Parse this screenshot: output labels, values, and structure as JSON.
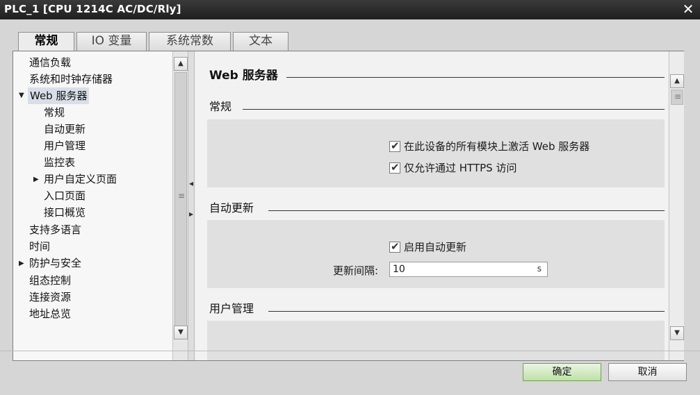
{
  "window": {
    "title": "PLC_1 [CPU 1214C AC/DC/Rly]",
    "close_glyph": "✕"
  },
  "tabs": [
    {
      "label": "常规",
      "active": true
    },
    {
      "label": "IO 变量",
      "active": false
    },
    {
      "label": "系统常数",
      "active": false
    },
    {
      "label": "文本",
      "active": false
    }
  ],
  "nav": {
    "items": [
      {
        "label": "通信负载"
      },
      {
        "label": "系统和时钟存储器"
      },
      {
        "label": "Web 服务器",
        "expanded": true,
        "selected": true
      },
      {
        "label": "常规"
      },
      {
        "label": "自动更新"
      },
      {
        "label": "用户管理"
      },
      {
        "label": "监控表"
      },
      {
        "label": "用户自定义页面",
        "collapsed": true
      },
      {
        "label": "入口页面"
      },
      {
        "label": "接口概览"
      },
      {
        "label": "支持多语言"
      },
      {
        "label": "时间"
      },
      {
        "label": "防护与安全",
        "collapsed": true
      },
      {
        "label": "组态控制"
      },
      {
        "label": "连接资源"
      },
      {
        "label": "地址总览"
      }
    ],
    "expand_glyph": "▼",
    "collapse_glyph": "▶"
  },
  "content": {
    "main_title": "Web 服务器",
    "sections": {
      "general": {
        "title": "常规",
        "checkboxes": [
          {
            "label": "在此设备的所有模块上激活 Web 服务器",
            "checked": true
          },
          {
            "label": "仅允许通过 HTTPS 访问",
            "checked": true
          }
        ]
      },
      "auto_update": {
        "title": "自动更新",
        "enable_checkbox": {
          "label": "启用自动更新",
          "checked": true
        },
        "interval_label": "更新间隔:",
        "interval_value": "10",
        "interval_unit": "s"
      },
      "user_management": {
        "title": "用户管理"
      }
    }
  },
  "buttons": {
    "ok": "确定",
    "cancel": "取消"
  },
  "glyphs": {
    "check": "✔",
    "up": "▲",
    "down": "▼",
    "left": "◀",
    "right": "▶",
    "grip": "≡"
  },
  "colors": {
    "ok_button": "#bfe0a8",
    "selection": "#d9dfe8",
    "titlebar": "#1f1f1f"
  }
}
